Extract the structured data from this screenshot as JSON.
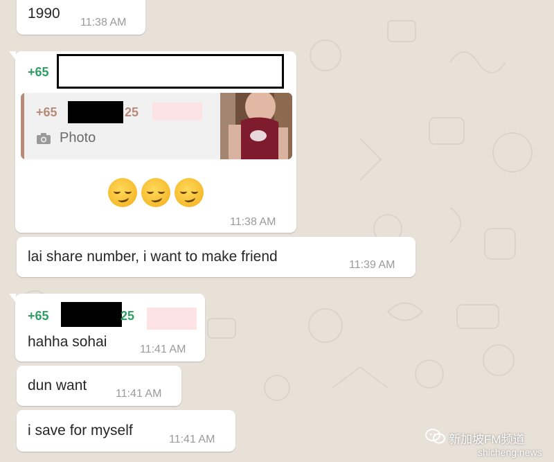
{
  "colors": {
    "chat_background": "#e7e1d8",
    "bubble": "#ffffff",
    "sender_green": "#2f9e63",
    "quote_sender": "#b88a78",
    "timestamp": "#9a9a9a"
  },
  "messages": [
    {
      "text": "1990",
      "time": "11:38 AM"
    },
    {
      "sender": "+65",
      "quote": {
        "sender_prefix": "+65",
        "sender_suffix": "25",
        "label": "Photo",
        "icon": "camera-icon"
      },
      "emoji": [
        "smirk-emoji",
        "smirk-emoji",
        "smirk-emoji"
      ],
      "time": "11:38 AM"
    },
    {
      "text": "lai share number, i want to make friend",
      "time": "11:39 AM"
    },
    {
      "sender_prefix": "+65",
      "sender_suffix": "25",
      "text": "hahha sohai",
      "time": "11:41 AM"
    },
    {
      "text": "dun want",
      "time": "11:41 AM"
    },
    {
      "text": "i save for myself",
      "time": "11:41 AM"
    }
  ],
  "watermark": {
    "channel": "新加坡FM频道",
    "site": "shicheng.news",
    "icon": "wechat-icon"
  }
}
